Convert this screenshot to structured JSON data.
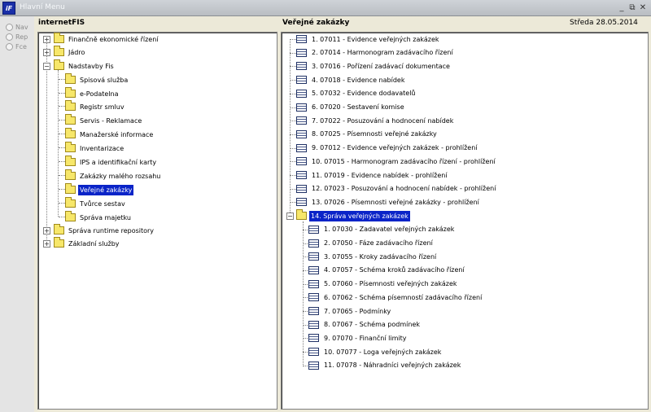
{
  "window": {
    "title": "Hlavní Menu",
    "icon": "iF"
  },
  "left_rail": {
    "options": [
      "Nav",
      "Rep",
      "Fce"
    ]
  },
  "left_panel": {
    "header": "internetFIS",
    "tree": [
      {
        "label": "Finančně ekonomické řízení",
        "state": "collapsed"
      },
      {
        "label": "Jádro",
        "state": "collapsed"
      },
      {
        "label": "Nadstavby Fis",
        "state": "expanded",
        "children": [
          "Spisová služba",
          "e-Podatelna",
          "Registr smluv",
          "Servis - Reklamace",
          "Manažerské informace",
          "Inventarizace",
          "IPS a identifikační karty",
          "Zakázky malého rozsahu",
          "Veřejné zakázky",
          "Tvůrce sestav",
          "Správa majetku"
        ]
      },
      {
        "label": "Správa runtime repository",
        "state": "collapsed"
      },
      {
        "label": "Základní služby",
        "state": "collapsed"
      }
    ],
    "selected": "Veřejné zakázky"
  },
  "right_panel": {
    "header": "Veřejné zakázky",
    "date": "Středa  28.05.2014",
    "items": [
      "1.  07011 - Evidence veřejných zakázek",
      "2.  07014 - Harmonogram zadávacího řízení",
      "3.  07016 - Pořízení zadávací dokumentace",
      "4.  07018 - Evidence nabídek",
      "5.  07032 - Evidence dodavatelů",
      "6.  07020 - Sestavení komise",
      "7.  07022 - Posuzování a hodnocení nabídek",
      "8.  07025 - Písemnosti veřejné zakázky",
      "9.  07012 - Evidence veřejných zakázek - prohlížení",
      "10. 07015 - Harmonogram zadávacího řízení - prohlížení",
      "11. 07019 - Evidence nabídek - prohlížení",
      "12. 07023 - Posuzování a hodnocení nabídek - prohlížení",
      "13. 07026 - Písemnosti veřejné zakázky - prohlížení"
    ],
    "folder": {
      "label": "14. Správa veřejných zakázek",
      "children": [
        "1.  07030 - Zadavatel veřejných zakázek",
        "2.  07050 - Fáze zadávacího řízení",
        "3.  07055 - Kroky zadávacího řízení",
        "4.  07057 - Schéma kroků zadávacího řízení",
        "5.  07060 - Písemnosti veřejných zakázek",
        "6.  07062 - Schéma písemností zadávacího řízení",
        "7.  07065 - Podmínky",
        "8.  07067 - Schéma podmínek",
        "9.  07070 - Finanční limity",
        "10. 07077 - Loga veřejných zakázek",
        "11. 07078 - Náhradníci veřejných zakázek"
      ]
    }
  },
  "icons": {
    "module": "document-list-icon",
    "group": "folder-icon"
  }
}
